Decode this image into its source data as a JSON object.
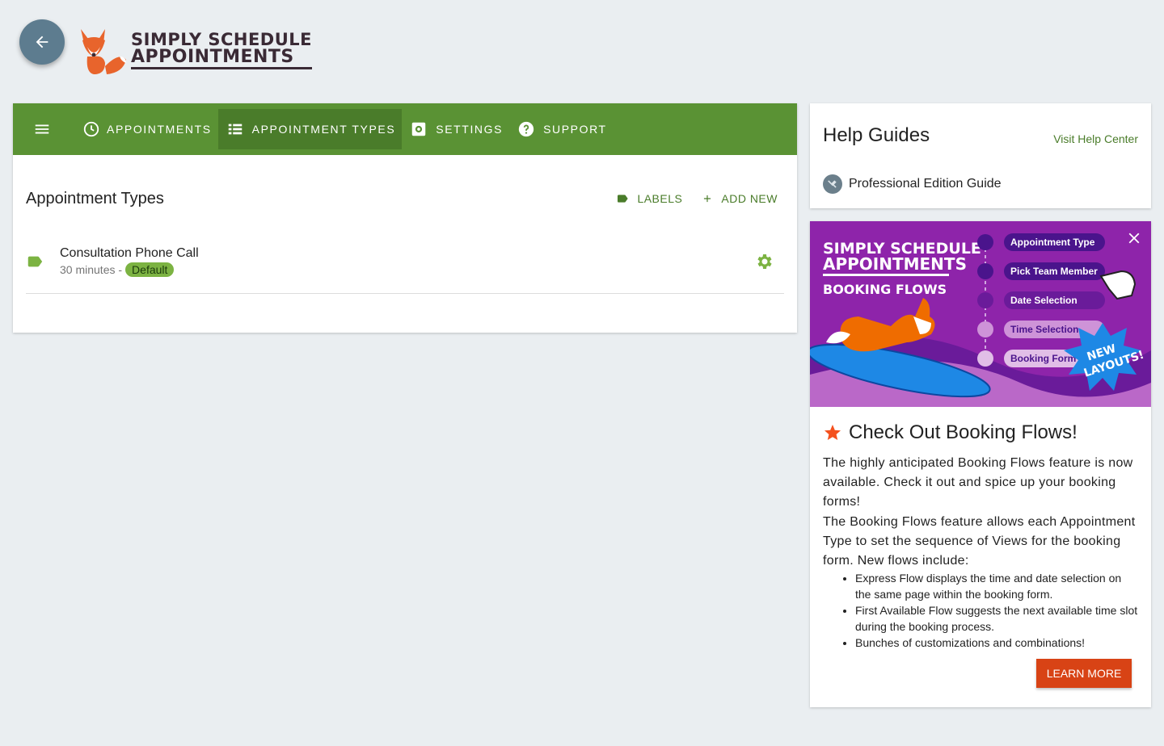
{
  "brand": {
    "line1": "SIMPLY SCHEDULE",
    "line2": "APPOINTMENTS"
  },
  "nav": {
    "items": [
      {
        "label": "APPOINTMENTS",
        "icon": "clock-icon"
      },
      {
        "label": "APPOINTMENT TYPES",
        "icon": "list-icon",
        "active": true
      },
      {
        "label": "SETTINGS",
        "icon": "settings-icon"
      },
      {
        "label": "SUPPORT",
        "icon": "help-icon"
      }
    ]
  },
  "main": {
    "title": "Appointment Types",
    "labels_btn": "LABELS",
    "add_new_btn": "ADD NEW",
    "types": [
      {
        "name": "Consultation Phone Call",
        "duration": "30 minutes -",
        "badge": "Default"
      }
    ]
  },
  "help": {
    "title": "Help Guides",
    "link": "Visit Help Center",
    "guide": "Professional Edition Guide"
  },
  "promo": {
    "banner": {
      "brand1": "SIMPLY SCHEDULE",
      "brand2": "APPOINTMENTS",
      "subtitle": "BOOKING FLOWS",
      "steps": [
        "Appointment Type",
        "Pick Team Member",
        "Date Selection",
        "Time Selection",
        "Booking Form"
      ],
      "burst1": "NEW",
      "burst2": "LAYOUTS!"
    },
    "title": "Check Out Booking Flows!",
    "p1": "The highly anticipated Booking Flows feature is now available. Check it out and spice up your booking forms!",
    "p2": "The Booking Flows feature allows each Appointment Type to set the sequence of Views for the booking form. New flows include:",
    "bullets": [
      "Express Flow displays the time and date selection on the same page within the booking form.",
      "First Available Flow suggests the next available time slot during the booking process.",
      "Bunches of customizations and combinations!"
    ],
    "button": "LEARN MORE"
  },
  "colors": {
    "nav_green": "#5a9234",
    "accent_green": "#4a7c2a",
    "badge_green": "#7cb342",
    "promo_orange": "#d84315",
    "banner_purple": "#8e24aa"
  }
}
